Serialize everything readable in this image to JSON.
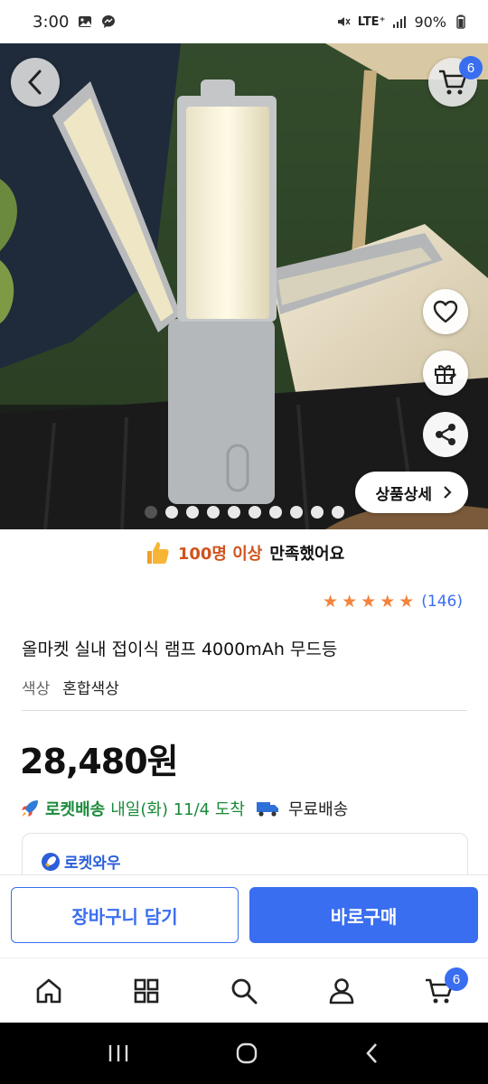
{
  "status_bar": {
    "time": "3:00",
    "network": "LTE⁺",
    "battery": "90%"
  },
  "hero": {
    "cart_badge": "6",
    "detail_button_label": "상품상세",
    "dots_total": 10,
    "dots_active_index": 0
  },
  "satisfaction": {
    "highlight": "100명 이상",
    "rest": "만족했어요"
  },
  "rating": {
    "stars": 5,
    "count": "(146)"
  },
  "product": {
    "title": "올마켓 실내 접이식 램프 4000mAh 무드등",
    "option_label": "색상",
    "option_value": "혼합색상",
    "price": "28,480원"
  },
  "delivery": {
    "rocket_label": "로켓배송",
    "date_text": "내일(화) 11/4 도착",
    "free_text": "무료배송"
  },
  "wow": {
    "label": "로켓와우"
  },
  "cta": {
    "cart_label": "장바구니 담기",
    "buy_label": "바로구매"
  },
  "bottom_nav": {
    "cart_badge": "6"
  },
  "colors": {
    "accent": "#3a6ef0",
    "rocket_green": "#1a8a3a",
    "highlight_orange": "#d0531c",
    "star": "#f4833c"
  }
}
